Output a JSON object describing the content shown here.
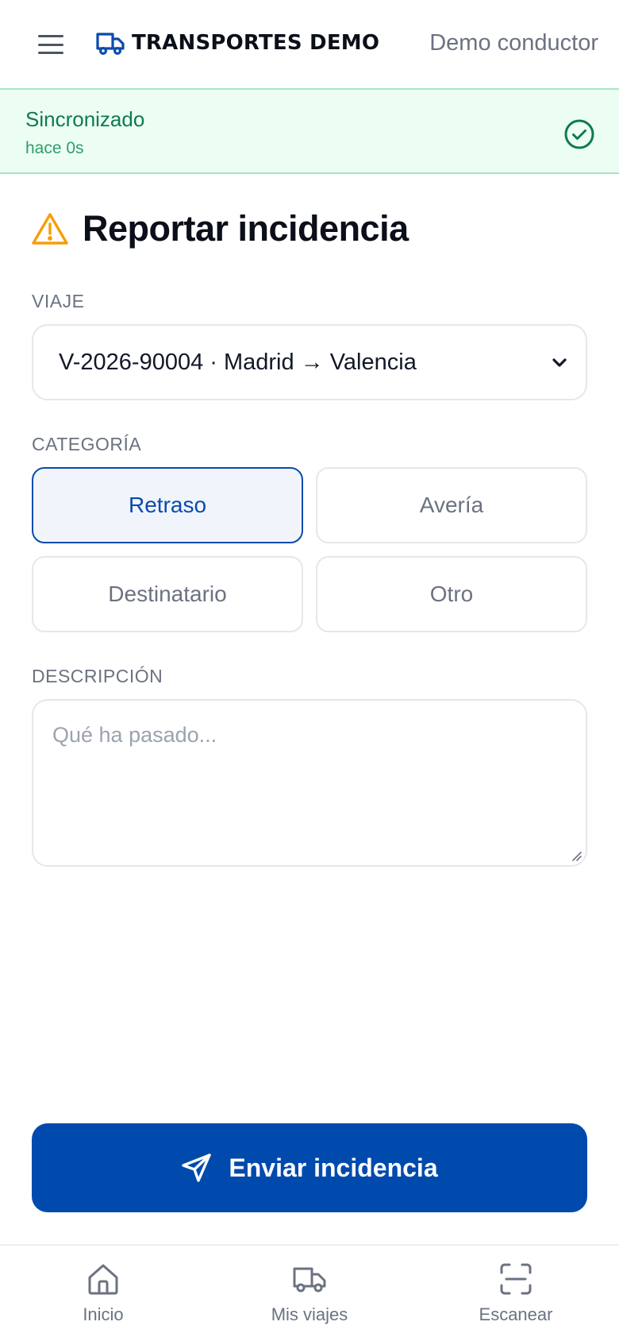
{
  "header": {
    "brand": "TRANSPORTES DEMO",
    "user": "Demo conductor",
    "brand_color": "#0a4bab"
  },
  "sync": {
    "title": "Sincronizado",
    "subtitle": "hace 0s",
    "color": "#0f7a4f"
  },
  "page": {
    "title": "Reportar incidencia",
    "warning_color": "#f59e0b"
  },
  "form": {
    "trip_label": "VIAJE",
    "trip_value": "V-2026-90004 · Madrid → Valencia",
    "category_label": "CATEGORÍA",
    "categories": [
      {
        "label": "Retraso",
        "selected": true
      },
      {
        "label": "Avería",
        "selected": false
      },
      {
        "label": "Destinatario",
        "selected": false
      },
      {
        "label": "Otro",
        "selected": false
      }
    ],
    "description_label": "DESCRIPCIÓN",
    "description_placeholder": "Qué ha pasado...",
    "submit_label": "Enviar incidencia",
    "accent": "#004aad"
  },
  "tabbar": {
    "items": [
      {
        "label": "Inicio",
        "icon": "home-icon"
      },
      {
        "label": "Mis viajes",
        "icon": "truck-icon"
      },
      {
        "label": "Escanear",
        "icon": "scan-icon"
      }
    ]
  }
}
